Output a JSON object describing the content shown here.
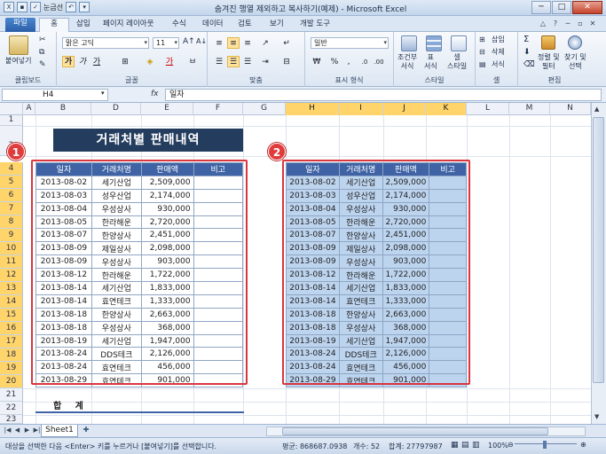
{
  "window": {
    "title": "숨겨진 행열 제외하고 복사하기(예제) - Microsoft Excel",
    "qat_label": "눈금선",
    "buttons": {
      "minimize": "─",
      "maximize": "□",
      "close": "✕"
    }
  },
  "tabs": [
    "파일",
    "홈",
    "삽입",
    "페이지 레이아웃",
    "수식",
    "데이터",
    "검토",
    "보기",
    "개발 도구"
  ],
  "ribbon": {
    "clipboard": {
      "label": "클립보드",
      "paste": "붙여넣기"
    },
    "font": {
      "label": "글꼴",
      "name": "맑은 고딕",
      "size": "11",
      "bold": "가",
      "italic": "가",
      "underline": "가"
    },
    "alignment": {
      "label": "맞춤"
    },
    "number": {
      "label": "표시 형식",
      "format": "일반",
      "percent": "%",
      "comma": ","
    },
    "styles": {
      "label": "스타일",
      "conditional": "조건부\n서식",
      "table": "표\n서식",
      "cell": "셀\n스타일"
    },
    "cells": {
      "label": "셀",
      "insert": "삽입",
      "delete": "삭제",
      "format": "서식"
    },
    "editing": {
      "label": "편집",
      "sort": "정렬 및\n필터",
      "find": "찾기 및\n선택"
    }
  },
  "formula_bar": {
    "cell": "H4",
    "fx": "fx",
    "content": "일자"
  },
  "columns": [
    "A",
    "B",
    "D",
    "E",
    "F",
    "G",
    "H",
    "I",
    "J",
    "K",
    "L",
    "M",
    "N"
  ],
  "rows": [
    "1",
    "2",
    "4",
    "5",
    "6",
    "7",
    "8",
    "9",
    "10",
    "11",
    "12",
    "13",
    "14",
    "15",
    "16",
    "17",
    "18",
    "19",
    "20",
    "21",
    "22",
    "23"
  ],
  "sheet_title": "거래처별 판매내역",
  "badges": [
    "1",
    "2"
  ],
  "table_headers": [
    "일자",
    "거래처명",
    "판매액",
    "비고"
  ],
  "table_rows": [
    [
      "2013-08-02",
      "세기산업",
      "2,509,000",
      ""
    ],
    [
      "2013-08-03",
      "성우산업",
      "2,174,000",
      ""
    ],
    [
      "2013-08-04",
      "우성상사",
      "930,000",
      ""
    ],
    [
      "2013-08-05",
      "한라해운",
      "2,720,000",
      ""
    ],
    [
      "2013-08-07",
      "한양상사",
      "2,451,000",
      ""
    ],
    [
      "2013-08-09",
      "제일상사",
      "2,098,000",
      ""
    ],
    [
      "2013-08-09",
      "우성상사",
      "903,000",
      ""
    ],
    [
      "2013-08-12",
      "한라해운",
      "1,722,000",
      ""
    ],
    [
      "2013-08-14",
      "세기산업",
      "1,833,000",
      ""
    ],
    [
      "2013-08-14",
      "효연테크",
      "1,333,000",
      ""
    ],
    [
      "2013-08-18",
      "한양상사",
      "2,663,000",
      ""
    ],
    [
      "2013-08-18",
      "우성상사",
      "368,000",
      ""
    ],
    [
      "2013-08-19",
      "세기산업",
      "1,947,000",
      ""
    ],
    [
      "2013-08-24",
      "DDS테크",
      "2,126,000",
      ""
    ],
    [
      "2013-08-24",
      "효연테크",
      "456,000",
      ""
    ],
    [
      "2013-08-29",
      "효연테크",
      "901,000",
      ""
    ]
  ],
  "sum_label": "합 계",
  "sheet_tab": "Sheet1",
  "status": {
    "message": "대상을 선택한 다음 <Enter> 키를 누르거나 [붙여넣기]를 선택합니다.",
    "average": "평균: 868687.0938",
    "count": "개수: 52",
    "sum": "합계: 27797987",
    "zoom": "100%"
  },
  "colors": {
    "header_fill": "#3f63a5",
    "title_fill": "#243d5e",
    "highlight": "#d9363e",
    "selection_fill": "#bdd4ef"
  }
}
